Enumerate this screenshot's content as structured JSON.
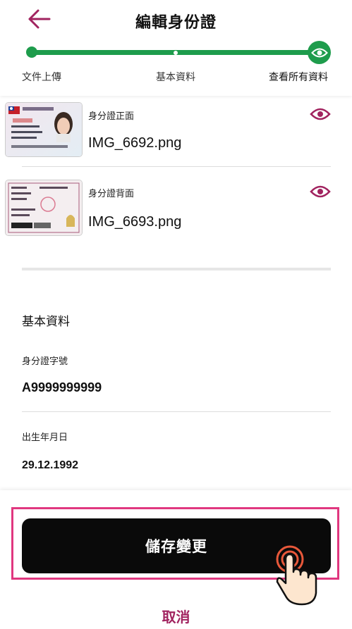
{
  "header": {
    "title": "編輯身份證",
    "back_icon": "arrow-left-icon",
    "accent_color": "#a1235f"
  },
  "stepper": {
    "color": "#1e9c4c",
    "steps": [
      {
        "label": "文件上傳"
      },
      {
        "label": "基本資料"
      },
      {
        "label": "查看所有資料"
      }
    ],
    "current_step_icon": "eye-icon"
  },
  "documents": [
    {
      "label": "身分證正面",
      "filename": "IMG_6692.png",
      "action_icon": "eye-icon"
    },
    {
      "label": "身分證背面",
      "filename": "IMG_6693.png",
      "action_icon": "eye-icon"
    }
  ],
  "basic_info": {
    "section_title": "基本資料",
    "fields": [
      {
        "label": "身分證字號",
        "value": "A9999999999"
      },
      {
        "label": "出生年月日",
        "value": "29.12.1992"
      }
    ]
  },
  "footer": {
    "save_label": "儲存變更",
    "cancel_label": "取消",
    "highlight_color": "#e0377f"
  }
}
